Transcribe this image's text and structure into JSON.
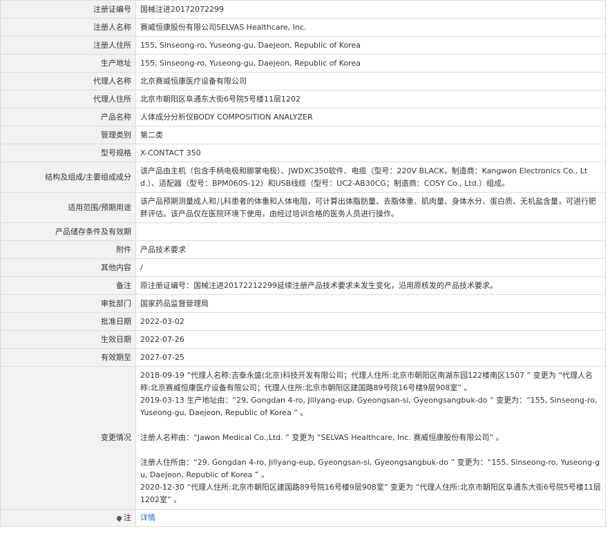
{
  "rows": [
    {
      "label": "注册证编号",
      "value": "国械注进20172072299"
    },
    {
      "label": "注册人名称",
      "value": "赛威恒康股份有限公司SELVAS Healthcare, Inc."
    },
    {
      "label": "注册人住所",
      "value": "155, Sinseong-ro, Yuseong-gu, Daejeon, Republic of Korea"
    },
    {
      "label": "生产地址",
      "value": "155, Sinseong-ro, Yuseong-gu, Daejeon, Republic of Korea"
    },
    {
      "label": "代理人名称",
      "value": "北京赛威恒康医疗设备有限公司"
    },
    {
      "label": "代理人住所",
      "value": "北京市朝阳区阜通东大街6号院5号楼11层1202"
    },
    {
      "label": "产品名称",
      "value": "人体成分分析仪BODY COMPOSITION ANALYZER"
    },
    {
      "label": "管理类别",
      "value": "第二类"
    },
    {
      "label": "型号规格",
      "value": "X-CONTACT 350"
    },
    {
      "label": "结构及组成/主要组成成分",
      "value": "该产品由主机（包含手柄电极和脚掌电极）、JWDXC350软件、电缆（型号：220V BLACK，制造商：Kangwon Electronics Co., Ltd.）、适配器（型号：BPM060S-12）和USB线缆（型号：UC2-AB30CG；制造商：COSY Co., Ltd.）组成。"
    },
    {
      "label": "适用范围/预期用途",
      "value": "该产品预期测量成人和儿科患者的体重和人体电阻，可计算出体脂肪量、去脂体重、肌肉量、身体水分、蛋白质、无机盐含量，可进行肥胖评估。该产品仅在医院环境下使用，由经过培训合格的医务人员进行操作。"
    },
    {
      "label": "产品储存条件及有效期",
      "value": ""
    },
    {
      "label": "附件",
      "value": "产品技术要求"
    },
    {
      "label": "其他内容",
      "value": "/"
    },
    {
      "label": "备注",
      "value": "原注册证编号：国械注进20172212299延续注册产品技术要求未发生变化，沿用原核发的产品技术要求。"
    },
    {
      "label": "审批部门",
      "value": "国家药品监督管理局"
    },
    {
      "label": "批准日期",
      "value": "2022-03-02"
    },
    {
      "label": "生效日期",
      "value": "2022-07-26"
    },
    {
      "label": "有效期至",
      "value": "2027-07-25"
    }
  ],
  "changes": {
    "label": "变更情况",
    "entry1": "2018-09-19 “代理人名称:吉泰永盛(北京)科技开发有限公司；代理人住所:北京市朝阳区南湖东园122楼南区1507 ” 变更为 “代理人名称:北京赛威恒康医疗设备有限公司；代理人住所:北京市朝阳区建国路89号院16号楼9层908室” 。",
    "entry2": "2019-03-13 生产地址由：“29, Gongdan 4-ro, Jillyang-eup, Gyeongsan-si, Gyeongsangbuk-do ” 变更为：“155, Sinseong-ro, Yuseong-gu, Daejeon, Republic of Korea ” 。",
    "entry3": "注册人名称由：“Jawon Medical Co.,Ltd. ” 变更为 “SELVAS Healthcare, Inc. 赛威恒康股份有限公司” 。",
    "entry4": "注册人住所由：“29, Gongdan 4-ro, Jillyang-eup, Gyeongsan-si, Gyeongsangbuk-do ” 变更为：“155, Sinseong-ro, Yuseong-gu, Daejeon, Republic of Korea ” 。",
    "entry5": "2020-12-30 “代理人住所:北京市朝阳区建国路89号院16号楼9层908室” 变更为 “代理人住所:北京市朝阳区阜通东大街6号院5号楼11层1202室” 。"
  },
  "note": {
    "label": "注",
    "link_text": "详情"
  }
}
